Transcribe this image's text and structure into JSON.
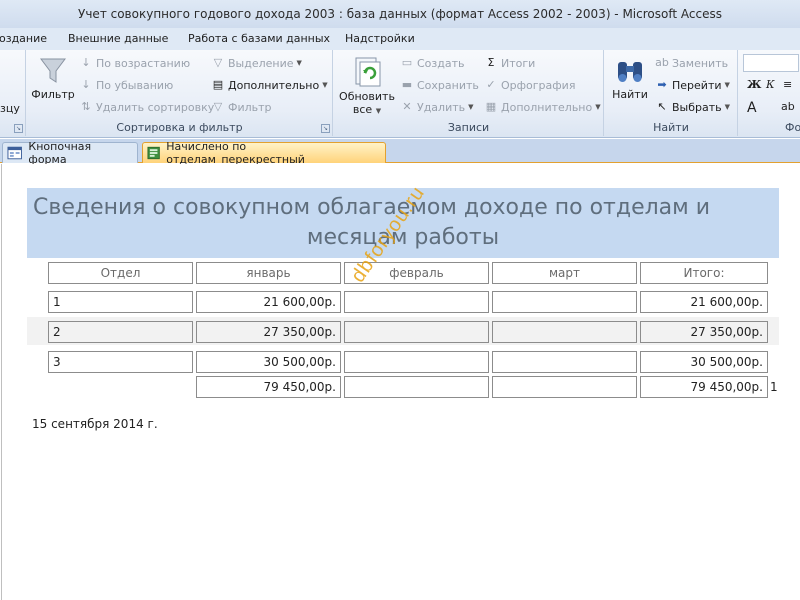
{
  "window": {
    "title": "Учет совокупного годового дохода 2003 : база данных (формат Access 2002 - 2003)  -  Microsoft Access"
  },
  "ribbon_tabs": [
    "оздание",
    "Внешние данные",
    "Работа с базами данных",
    "Надстройки"
  ],
  "ribbon": {
    "left_partial": "зцу",
    "sort_filter": {
      "label": "Сортировка и фильтр",
      "filter": "Фильтр",
      "asc": "По возрастанию",
      "desc": "По убыванию",
      "remove_sort": "Удалить сортировку",
      "selection": "Выделение",
      "advanced": "Дополнительно",
      "toggle_filter": "Фильтр"
    },
    "records": {
      "label": "Записи",
      "refresh_l1": "Обновить",
      "refresh_l2": "все",
      "new": "Создать",
      "save": "Сохранить",
      "delete": "Удалить",
      "totals": "Итоги",
      "spelling": "Орфография",
      "more": "Дополнительно"
    },
    "find": {
      "label": "Найти",
      "find": "Найти",
      "replace": "Заменить",
      "goto": "Перейти",
      "select": "Выбрать"
    },
    "format_partial": {
      "label": "Фо",
      "bold": "Ж",
      "italic": "К",
      "font_color": "A",
      "align": "≡",
      "abc": "ab"
    }
  },
  "doc_tabs": [
    "Кнопочная форма",
    "Начислено по отделам_перекрестный"
  ],
  "report": {
    "title_line1": "Сведения о совокупном облагаемом доходе по отделам и",
    "title_line2": "месяцам работы",
    "headers": [
      "Отдел",
      "январь",
      "февраль",
      "март",
      "Итого:"
    ],
    "rows": [
      {
        "dept": "1",
        "jan": "21 600,00р.",
        "feb": "",
        "mar": "",
        "total": "21 600,00р."
      },
      {
        "dept": "2",
        "jan": "27 350,00р.",
        "feb": "",
        "mar": "",
        "total": "27 350,00р."
      },
      {
        "dept": "3",
        "jan": "30 500,00р.",
        "feb": "",
        "mar": "",
        "total": "30 500,00р."
      }
    ],
    "totals": {
      "jan": "79 450,00р.",
      "feb": "",
      "mar": "",
      "total": "79 450,00р."
    },
    "page_number": "1",
    "date": "15 сентября 2014 г.",
    "watermark": "dbforyou.ru"
  }
}
